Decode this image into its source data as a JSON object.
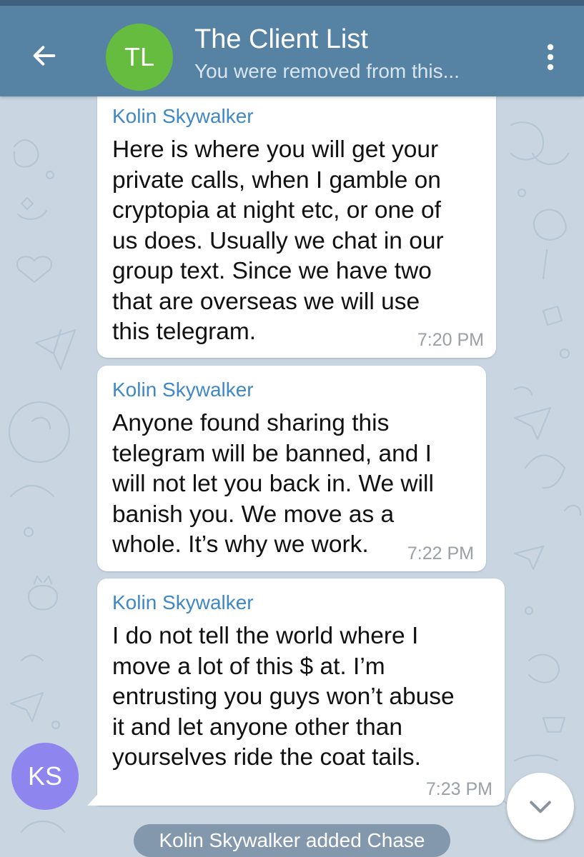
{
  "header": {
    "back_icon": "arrow-left-icon",
    "avatar_initials": "TL",
    "title": "The Client List",
    "subtitle": "You were removed from this...",
    "menu_icon": "more-vertical-icon"
  },
  "messages": [
    {
      "sender": "Kolin Skywalker",
      "text": "Here is where you will get your\nprivate calls, when I gamble on\ncryptopia at night etc, or one of\nus does. Usually we chat in our\ngroup text. Since we have two\nthat are overseas we will use\nthis telegram.",
      "time": "7:20 PM"
    },
    {
      "sender": "Kolin Skywalker",
      "text": "Anyone found sharing this\ntelegram will be banned, and I\nwill not let you back in. We will\nbanish you. We move as a\nwhole. It’s why we work.",
      "time": "7:22 PM"
    },
    {
      "sender": "Kolin Skywalker",
      "text": "I do not tell the world where I\nmove a lot of this $ at. I’m\nentrusting you guys won’t abuse\nit and let anyone other than\nyourselves ride the coat tails.",
      "time": "7:23 PM"
    }
  ],
  "sender_avatar": {
    "initials": "KS"
  },
  "service_message": "Kolin Skywalker added Chase",
  "scroll_down_icon": "chevron-down-icon",
  "colors": {
    "header_bg": "#5682a3",
    "avatar_tl": "#65bc3f",
    "avatar_ks": "#8e85ee",
    "sender_name": "#3f88c5",
    "wallpaper": "#c9d6e1"
  }
}
